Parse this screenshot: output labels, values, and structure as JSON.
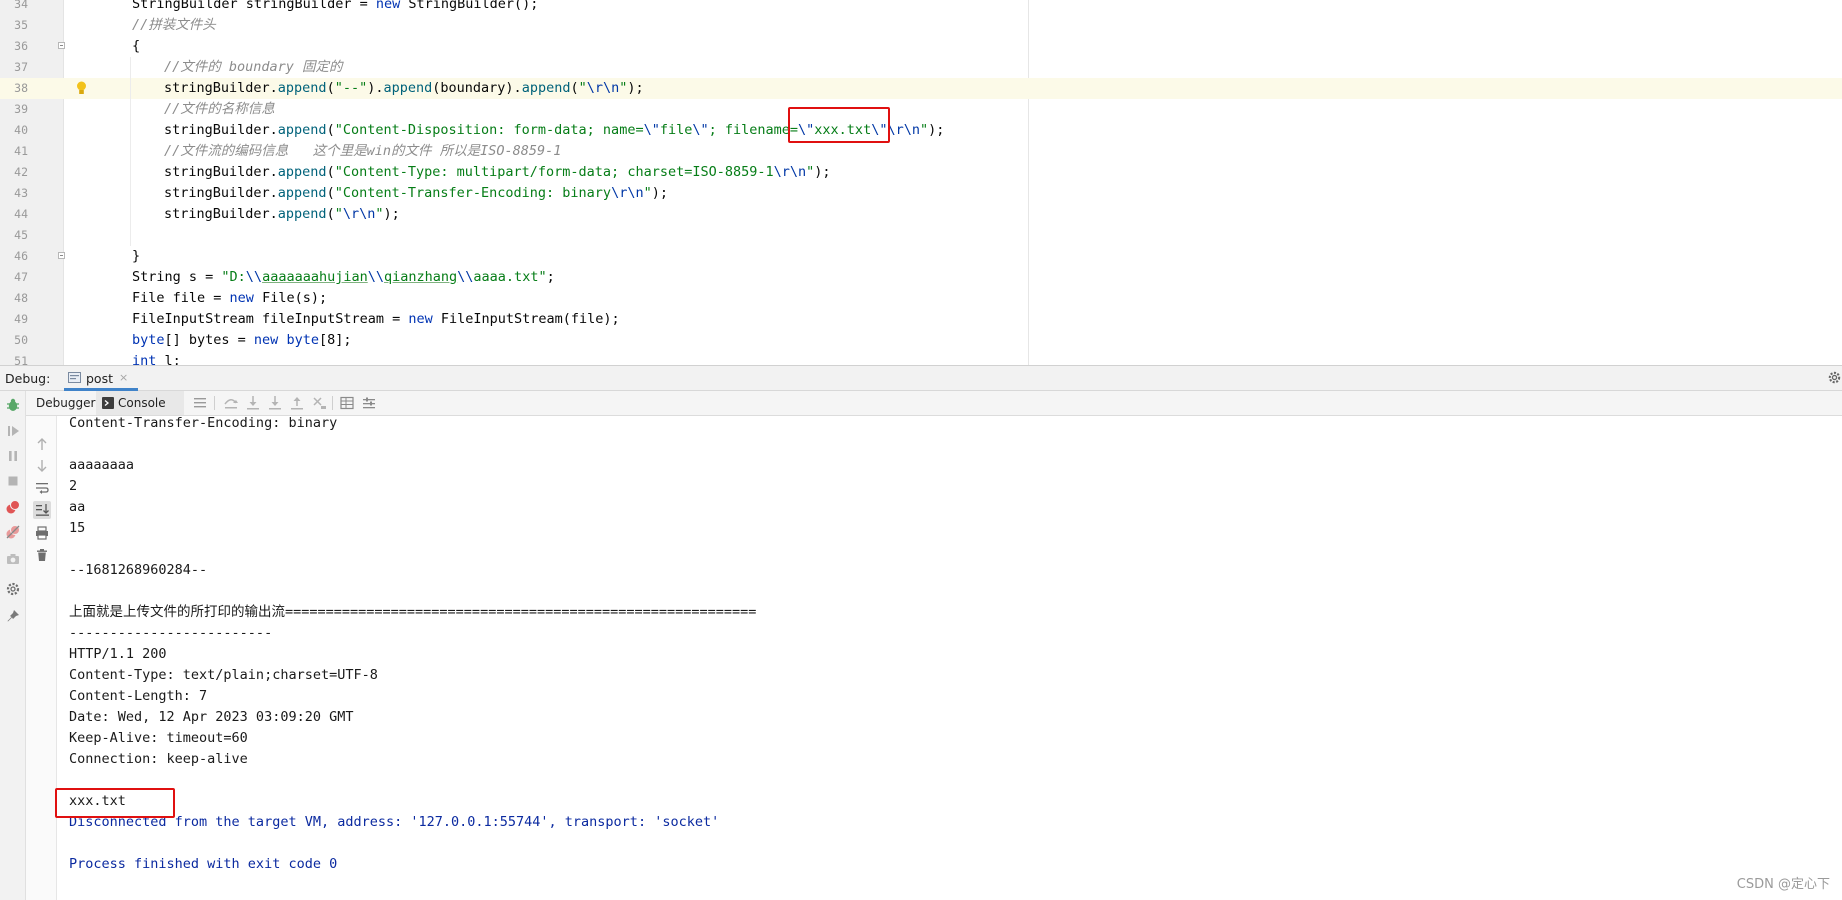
{
  "editor": {
    "lines": [
      {
        "num": "34",
        "indent": 1,
        "spans": [
          {
            "t": "StringBuilder stringBuilder = ",
            "c": ""
          },
          {
            "t": "new",
            "c": "k"
          },
          {
            "t": " StringBuilder();",
            "c": ""
          }
        ]
      },
      {
        "num": "35",
        "indent": 1,
        "spans": [
          {
            "t": "//拼装文件头",
            "c": "c"
          }
        ]
      },
      {
        "num": "36",
        "indent": 1,
        "fold": true,
        "spans": [
          {
            "t": "{",
            "c": ""
          }
        ]
      },
      {
        "num": "37",
        "indent": 2,
        "spans": [
          {
            "t": "//文件的 boundary 固定的",
            "c": "c"
          }
        ]
      },
      {
        "num": "38",
        "indent": 2,
        "current": true,
        "bulb": true,
        "spans": [
          {
            "t": "stringBuilder.",
            "c": ""
          },
          {
            "t": "append",
            "c": "m"
          },
          {
            "t": "(",
            "c": ""
          },
          {
            "t": "\"--\"",
            "c": "s"
          },
          {
            "t": ").",
            "c": ""
          },
          {
            "t": "append",
            "c": "m"
          },
          {
            "t": "(boundary).",
            "c": ""
          },
          {
            "t": "append",
            "c": "m"
          },
          {
            "t": "(",
            "c": ""
          },
          {
            "t": "\"",
            "c": "s"
          },
          {
            "t": "\\r\\n",
            "c": "e"
          },
          {
            "t": "\"",
            "c": "s"
          },
          {
            "t": ");",
            "c": ""
          }
        ]
      },
      {
        "num": "39",
        "indent": 2,
        "spans": [
          {
            "t": "//文件的名称信息",
            "c": "c"
          }
        ]
      },
      {
        "num": "40",
        "indent": 2,
        "spans": [
          {
            "t": "stringBuilder.",
            "c": ""
          },
          {
            "t": "append",
            "c": "m"
          },
          {
            "t": "(",
            "c": ""
          },
          {
            "t": "\"Content-Disposition: form-data; name=",
            "c": "s"
          },
          {
            "t": "\\\"",
            "c": "e"
          },
          {
            "t": "file",
            "c": "s"
          },
          {
            "t": "\\\"",
            "c": "e"
          },
          {
            "t": "; filename=",
            "c": "s"
          },
          {
            "t": "\\\"",
            "c": "e"
          },
          {
            "t": "xxx.txt",
            "c": "s"
          },
          {
            "t": "\\\"",
            "c": "e"
          },
          {
            "t": "\\r\\n",
            "c": "e"
          },
          {
            "t": "\"",
            "c": "s"
          },
          {
            "t": ");",
            "c": ""
          }
        ]
      },
      {
        "num": "41",
        "indent": 2,
        "spans": [
          {
            "t": "//文件流的编码信息   这个里是win的文件 所以是ISO-8859-1",
            "c": "c"
          }
        ]
      },
      {
        "num": "42",
        "indent": 2,
        "spans": [
          {
            "t": "stringBuilder.",
            "c": ""
          },
          {
            "t": "append",
            "c": "m"
          },
          {
            "t": "(",
            "c": ""
          },
          {
            "t": "\"Content-Type: multipart/form-data; charset=ISO-8859-1",
            "c": "s"
          },
          {
            "t": "\\r\\n",
            "c": "e"
          },
          {
            "t": "\"",
            "c": "s"
          },
          {
            "t": ");",
            "c": ""
          }
        ]
      },
      {
        "num": "43",
        "indent": 2,
        "spans": [
          {
            "t": "stringBuilder.",
            "c": ""
          },
          {
            "t": "append",
            "c": "m"
          },
          {
            "t": "(",
            "c": ""
          },
          {
            "t": "\"Content-Transfer-Encoding: binary",
            "c": "s"
          },
          {
            "t": "\\r\\n",
            "c": "e"
          },
          {
            "t": "\"",
            "c": "s"
          },
          {
            "t": ");",
            "c": ""
          }
        ]
      },
      {
        "num": "44",
        "indent": 2,
        "spans": [
          {
            "t": "stringBuilder.",
            "c": ""
          },
          {
            "t": "append",
            "c": "m"
          },
          {
            "t": "(",
            "c": ""
          },
          {
            "t": "\"",
            "c": "s"
          },
          {
            "t": "\\r\\n",
            "c": "e"
          },
          {
            "t": "\"",
            "c": "s"
          },
          {
            "t": ");",
            "c": ""
          }
        ]
      },
      {
        "num": "45",
        "indent": 2,
        "spans": []
      },
      {
        "num": "46",
        "indent": 1,
        "fold": true,
        "spans": [
          {
            "t": "}",
            "c": ""
          }
        ]
      },
      {
        "num": "47",
        "indent": 1,
        "spans": [
          {
            "t": "String s = ",
            "c": ""
          },
          {
            "t": "\"D:",
            "c": "s"
          },
          {
            "t": "\\\\",
            "c": "e"
          },
          {
            "t": "aaaaaaahujian",
            "c": "s u"
          },
          {
            "t": "\\\\",
            "c": "e"
          },
          {
            "t": "qianzhang",
            "c": "s u"
          },
          {
            "t": "\\\\",
            "c": "e"
          },
          {
            "t": "aaaa.txt\"",
            "c": "s"
          },
          {
            "t": ";",
            "c": ""
          }
        ]
      },
      {
        "num": "48",
        "indent": 1,
        "spans": [
          {
            "t": "File file = ",
            "c": ""
          },
          {
            "t": "new",
            "c": "k"
          },
          {
            "t": " File(s);",
            "c": ""
          }
        ]
      },
      {
        "num": "49",
        "indent": 1,
        "spans": [
          {
            "t": "FileInputStream fileInputStream = ",
            "c": ""
          },
          {
            "t": "new",
            "c": "k"
          },
          {
            "t": " FileInputStream(file);",
            "c": ""
          }
        ]
      },
      {
        "num": "50",
        "indent": 1,
        "spans": [
          {
            "t": "byte",
            "c": "k"
          },
          {
            "t": "[] bytes = ",
            "c": ""
          },
          {
            "t": "new",
            "c": "k"
          },
          {
            "t": " ",
            "c": ""
          },
          {
            "t": "byte",
            "c": "k"
          },
          {
            "t": "[8];",
            "c": ""
          }
        ]
      },
      {
        "num": "51",
        "indent": 1,
        "spans": [
          {
            "t": "int",
            "c": "k"
          },
          {
            "t": " l;",
            "c": ""
          }
        ]
      }
    ]
  },
  "debug": {
    "label": "Debug:",
    "tab_label": "post",
    "close_glyph": "×",
    "tabs": {
      "debugger": "Debugger",
      "console": "Console"
    }
  },
  "console": {
    "lines": [
      {
        "text": "Content-Transfer-Encoding: binary",
        "kind": "out"
      },
      {
        "text": "",
        "kind": "out"
      },
      {
        "text": "aaaaaaaa",
        "kind": "out"
      },
      {
        "text": "2",
        "kind": "out"
      },
      {
        "text": "aa",
        "kind": "out"
      },
      {
        "text": "15",
        "kind": "out"
      },
      {
        "text": "",
        "kind": "out"
      },
      {
        "text": "--1681268960284--",
        "kind": "out"
      },
      {
        "text": "",
        "kind": "out"
      },
      {
        "text": "上面就是上传文件的所打印的输出流==========================================================",
        "kind": "out"
      },
      {
        "text": "-------------------------",
        "kind": "out"
      },
      {
        "text": "HTTP/1.1 200",
        "kind": "out"
      },
      {
        "text": "Content-Type: text/plain;charset=UTF-8",
        "kind": "out"
      },
      {
        "text": "Content-Length: 7",
        "kind": "out"
      },
      {
        "text": "Date: Wed, 12 Apr 2023 03:09:20 GMT",
        "kind": "out"
      },
      {
        "text": "Keep-Alive: timeout=60",
        "kind": "out"
      },
      {
        "text": "Connection: keep-alive",
        "kind": "out"
      },
      {
        "text": "",
        "kind": "out"
      },
      {
        "text": "xxx.txt",
        "kind": "out"
      },
      {
        "text": "Disconnected from the target VM, address: '127.0.0.1:55744', transport: 'socket'",
        "kind": "sys"
      },
      {
        "text": "",
        "kind": "out"
      },
      {
        "text": "Process finished with exit code 0",
        "kind": "sys"
      }
    ]
  },
  "watermark": "CSDN @定心下",
  "colors": {
    "highlight": "#e01010",
    "tab_accent": "#4083c9",
    "keyword": "#0033b3",
    "string": "#067d17",
    "comment": "#8c8c8c"
  }
}
